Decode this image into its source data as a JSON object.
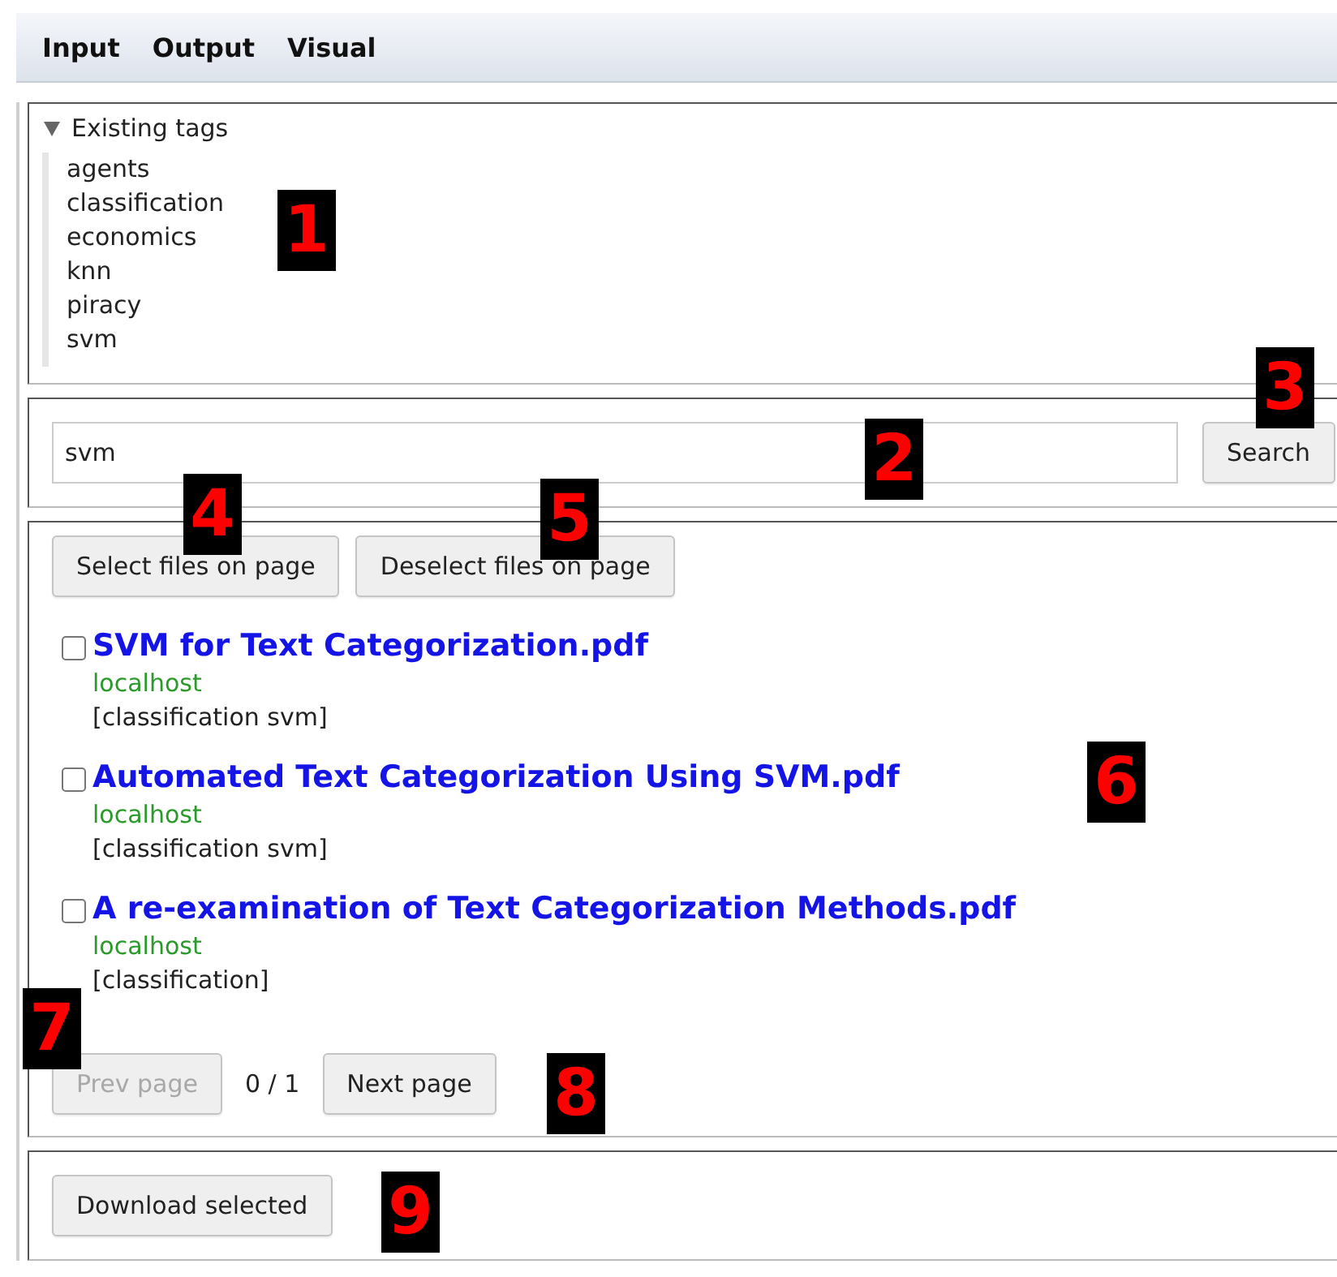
{
  "menu": [
    {
      "label": "Input"
    },
    {
      "label": "Output"
    },
    {
      "label": "Visual"
    }
  ],
  "tags_panel": {
    "title": "Existing tags",
    "expanded": true,
    "tags": [
      "agents",
      "classification",
      "economics",
      "knn",
      "piracy",
      "svm"
    ]
  },
  "search": {
    "value": "svm",
    "button": "Search"
  },
  "results": {
    "select_button": "Select files on page",
    "deselect_button": "Deselect files on page",
    "files": [
      {
        "title": "SVM for Text Categorization.pdf",
        "host": "localhost",
        "tags": "[classification svm]",
        "checked": false
      },
      {
        "title": "Automated Text Categorization Using SVM.pdf",
        "host": "localhost",
        "tags": "[classification svm]",
        "checked": false
      },
      {
        "title": "A re-examination of Text Categorization Methods.pdf",
        "host": "localhost",
        "tags": "[classification]",
        "checked": false
      }
    ],
    "pagination": {
      "prev": {
        "label": "Prev page",
        "disabled": true
      },
      "page": "0 / 1",
      "next": {
        "label": "Next page",
        "disabled": false
      }
    }
  },
  "download_button": "Download selected",
  "callouts": [
    "1",
    "2",
    "3",
    "4",
    "5",
    "6",
    "7",
    "8",
    "9"
  ]
}
